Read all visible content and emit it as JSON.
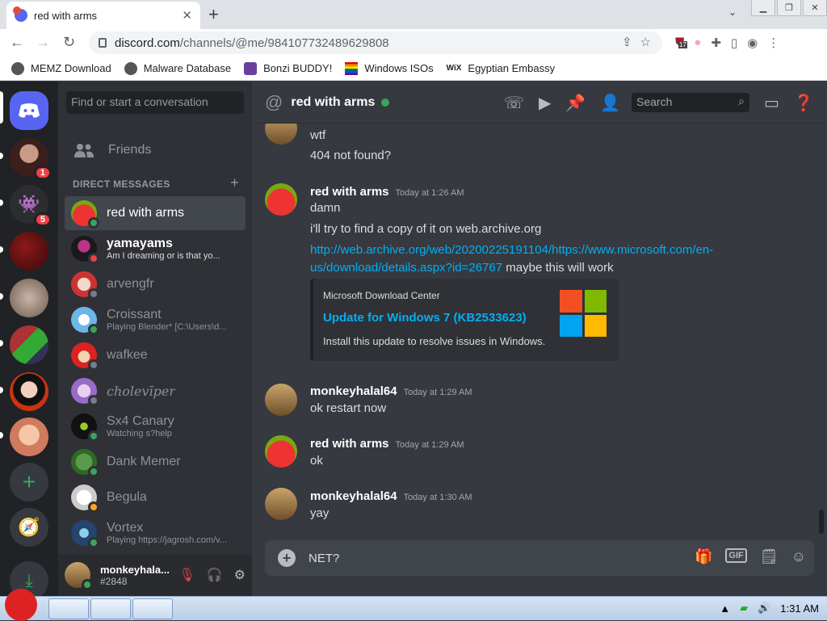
{
  "browser": {
    "tab_title": "red with arms",
    "url_host": "discord.com",
    "url_path": "/channels/@me/984107732489629808",
    "ext_badge": "17",
    "bookmarks": [
      "MEMZ Download",
      "Malware Database",
      "Bonzi BUDDY!",
      "Windows ISOs",
      "Egyptian Embassy"
    ]
  },
  "guilds": {
    "badges": [
      "1",
      "5"
    ]
  },
  "sidebar": {
    "search_placeholder": "Find or start a conversation",
    "friends_label": "Friends",
    "dm_header": "DIRECT MESSAGES",
    "dms": [
      {
        "name": "red with arms",
        "sub": "",
        "status": "online"
      },
      {
        "name": "yamayams",
        "sub": "Am I dreaming or is that yo...",
        "status": "dnd"
      },
      {
        "name": "arvengfr",
        "sub": "",
        "status": "offline"
      },
      {
        "name": "Croissant",
        "sub": "Playing Blender* [C:\\Users\\d...",
        "status": "online"
      },
      {
        "name": "wafkee",
        "sub": "",
        "status": "offline"
      },
      {
        "name": "cholevīper",
        "sub": "",
        "status": "offline"
      },
      {
        "name": "Sx4 Canary",
        "sub": "Watching s?help",
        "status": "online"
      },
      {
        "name": "Dank Memer",
        "sub": "",
        "status": "online"
      },
      {
        "name": "Begula",
        "sub": "",
        "status": "idle"
      },
      {
        "name": "Vortex",
        "sub": "Playing https://jagrosh.com/v...",
        "status": "online"
      }
    ],
    "user": {
      "name": "monkeyhala...",
      "tag": "#2848"
    }
  },
  "chat": {
    "channel_name": "red with arms",
    "search_placeholder": "Search",
    "messages": [
      {
        "author": "",
        "time": "",
        "lines": [
          "wtf",
          "404 not found?"
        ]
      },
      {
        "author": "red with arms",
        "time": "Today at 1:26 AM",
        "lines": [
          "damn",
          "i'll try to find a copy of it on web.archive.org"
        ],
        "link_line1": "http://web.archive.org/web/20200225191104/https://www.microsoft.com/en-",
        "link_line2": "us/download/details.aspx?id=26767",
        "link_suffix": " maybe this will work"
      },
      {
        "author": "monkeyhalal64",
        "time": "Today at 1:29 AM",
        "lines": [
          "ok restart now"
        ]
      },
      {
        "author": "red with arms",
        "time": "Today at 1:29 AM",
        "lines": [
          "ok"
        ]
      },
      {
        "author": "monkeyhalal64",
        "time": "Today at 1:30 AM",
        "lines": [
          "yay"
        ]
      }
    ],
    "embed": {
      "provider": "Microsoft Download Center",
      "title": "Update for Windows 7 (KB2533623)",
      "description": "Install this update to resolve issues in Windows."
    },
    "composer_text": "NET?",
    "gif_label": "GIF"
  },
  "taskbar": {
    "clock": "1:31 AM"
  },
  "colors": {
    "blurple": "#5865f2",
    "online": "#3ba55d",
    "link": "#00aff4"
  }
}
